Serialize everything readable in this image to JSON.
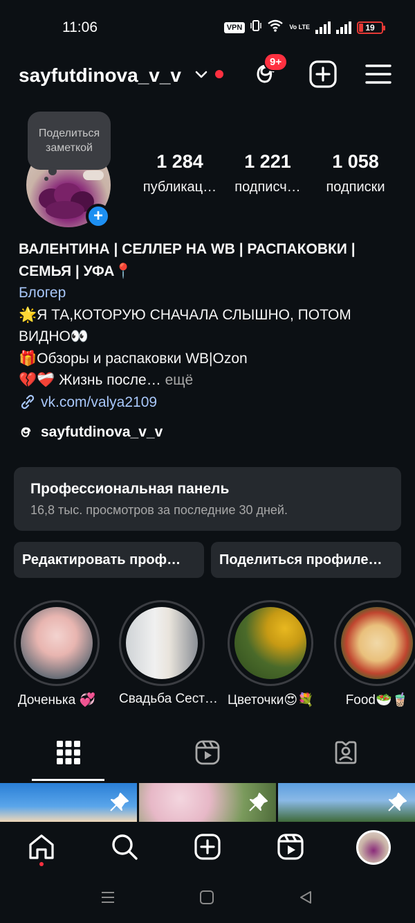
{
  "status_bar": {
    "time": "11:06",
    "vpn": "VPN",
    "lte": "Vo LTE",
    "battery": "19",
    "battery_level_percent": 19
  },
  "header": {
    "username": "sayfutdinova_v_v",
    "notification_badge": "9+"
  },
  "profile": {
    "note_bubble": "Поделиться заметкой",
    "stats": [
      {
        "value": "1 284",
        "label": "публикац…"
      },
      {
        "value": "1 221",
        "label": "подписч…"
      },
      {
        "value": "1 058",
        "label": "подписки"
      }
    ]
  },
  "bio": {
    "name_line1": "ВАЛЕНТИНА | СЕЛЛЕР НА WB | РАСПАКОВКИ |",
    "name_line2": "СЕМЬЯ | УФА📍",
    "category": "Блогер",
    "line1": "🌟Я ТА,КОТОРУЮ СНАЧАЛА СЛЫШНО, ПОТОМ",
    "line2": "ВИДНО👀",
    "line3": "🎁Обзоры и распаковки WB|Ozon",
    "line4": "💔❤️‍🩹 Жизнь после…",
    "more": " ещё",
    "link": "vk.com/valya2109",
    "threads_handle": "sayfutdinova_v_v"
  },
  "pro_panel": {
    "title": "Профессиональная панель",
    "subtitle": "16,8 тыс. просмотров за последние 30 дней."
  },
  "buttons": {
    "edit": "Редактировать проф…",
    "share": "Поделиться профиле…"
  },
  "highlights": [
    {
      "caption": "Доченька 💞"
    },
    {
      "caption": "Свадьба Сест…"
    },
    {
      "caption": "Цветочки😍💐"
    },
    {
      "caption": "Food🥗🧋"
    }
  ],
  "tabs": [
    "grid-tab",
    "reels-tab",
    "tagged-tab"
  ],
  "colors": {
    "background": "#0c1014",
    "surface": "#25292e",
    "accent_blue": "#1d8ff2",
    "link_blue": "#a8c7fa",
    "notification_red": "#ff3040"
  }
}
